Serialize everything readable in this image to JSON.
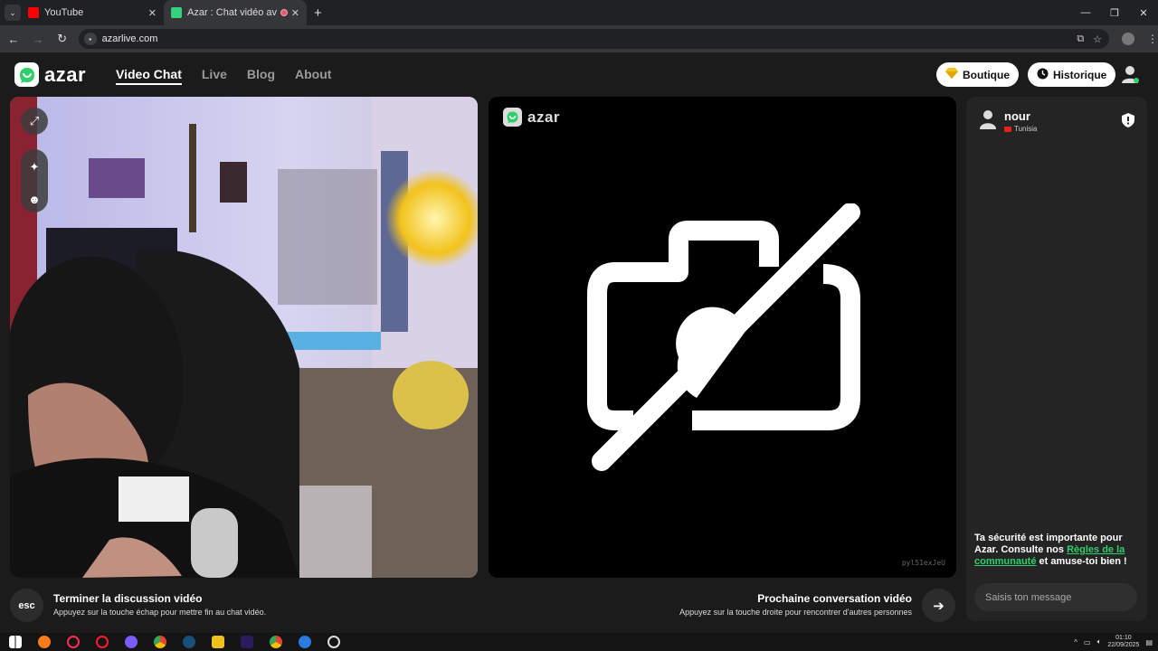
{
  "browser": {
    "tabs": [
      {
        "title": "YouTube",
        "favicon_color": "#ff0000",
        "active": false
      },
      {
        "title": "Azar : Chat vidéo avec de n",
        "favicon_color": "#34d27b",
        "active": true
      }
    ],
    "url": "azarlive.com"
  },
  "header": {
    "brand": "azar",
    "nav": [
      "Video Chat",
      "Live",
      "Blog",
      "About"
    ],
    "boutique_label": "Boutique",
    "historique_label": "Historique"
  },
  "peer": {
    "brand": "azar",
    "id_code": "pyl51exJeU"
  },
  "chat": {
    "username": "nour",
    "country": "Tunisia",
    "safety_prefix": "Ta sécurité est importante pour Azar. Consulte nos ",
    "safety_link": "Règles de la communauté",
    "safety_suffix": " et amuse-toi bien !",
    "input_placeholder": "Saisis ton message"
  },
  "actions": {
    "esc_label": "esc",
    "end_title": "Terminer la discussion vidéo",
    "end_sub": "Appuyez sur la touche échap pour mettre fin au chat vidéo.",
    "next_title": "Prochaine conversation vidéo",
    "next_sub": "Appuyez sur la touche droite pour rencontrer d'autres personnes"
  },
  "taskbar": {
    "time": "01:10",
    "date": "22/09/2025"
  },
  "colors": {
    "accent": "#2fd06b",
    "background": "#1b1b1b",
    "panel": "#242424"
  }
}
